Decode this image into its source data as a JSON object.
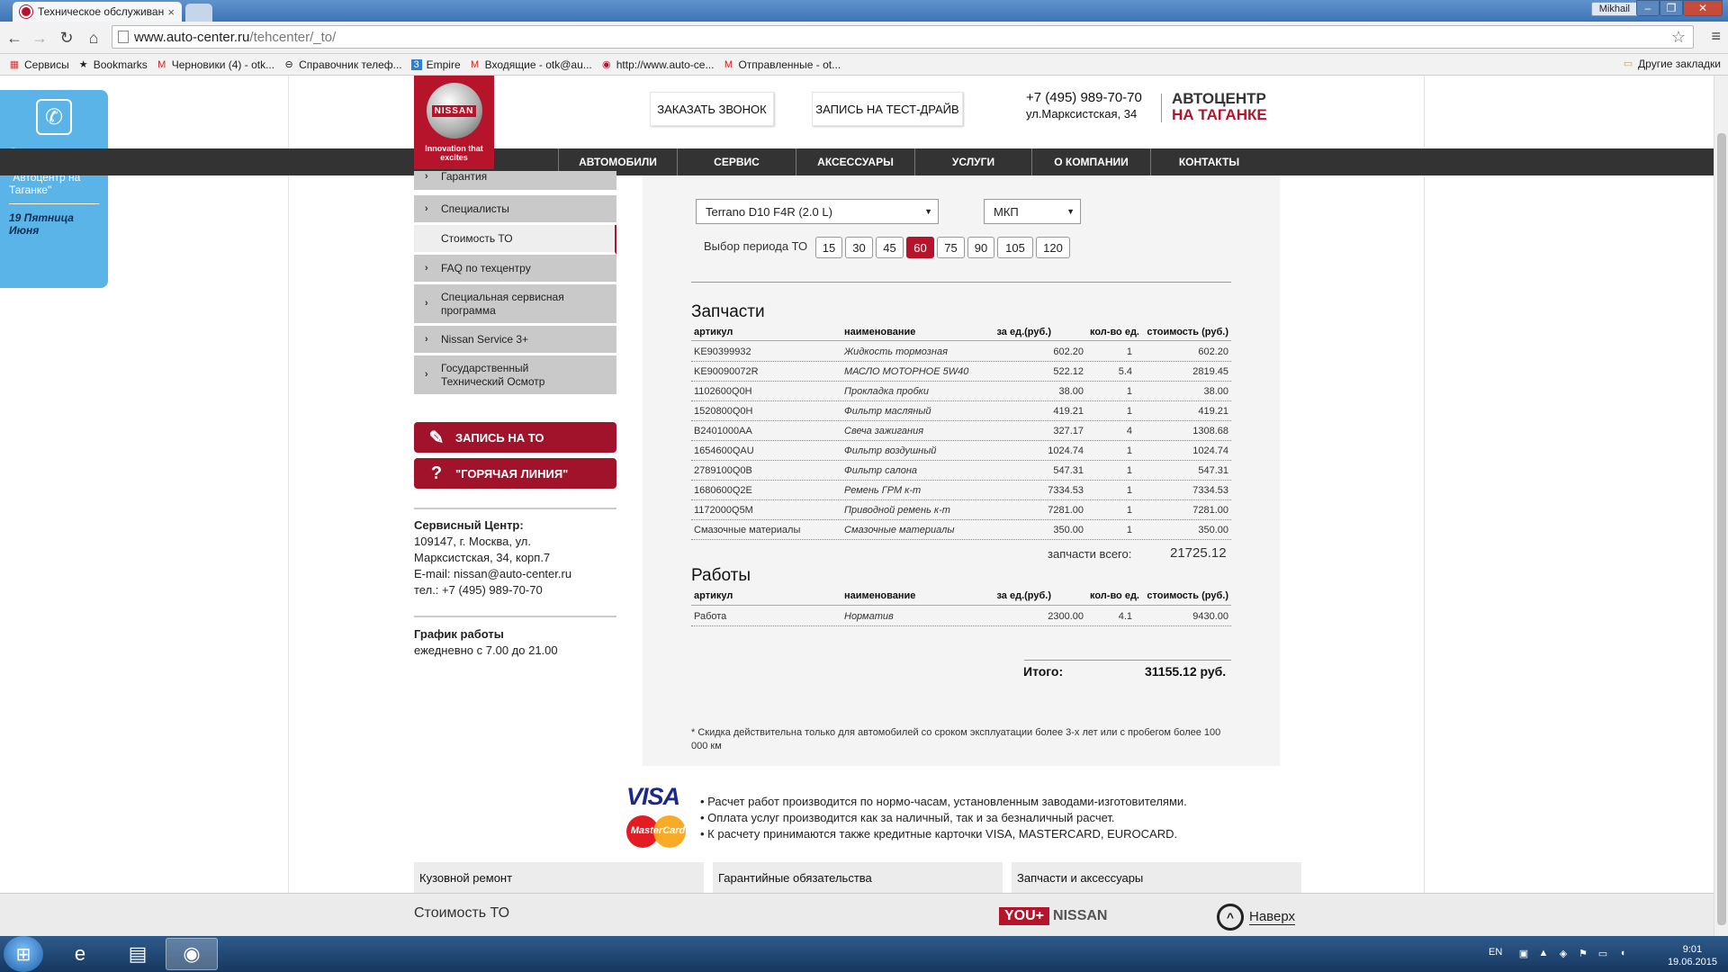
{
  "browser": {
    "tab_title": "Техническое обслуживан",
    "tab_close": "×",
    "user": "Mikhail",
    "url_host": "www.auto-center.ru",
    "url_path": "/tehcenter/_to/",
    "bookmarks": [
      {
        "icon": "apps-icon",
        "label": "Сервисы"
      },
      {
        "icon": "star-icon",
        "label": "Bookmarks"
      },
      {
        "icon": "gmail-icon",
        "label": "Черновики (4) - otk..."
      },
      {
        "icon": "phone-book-icon",
        "label": "Справочник телеф..."
      },
      {
        "icon": "empire-icon",
        "label": "Empire"
      },
      {
        "icon": "gmail-icon",
        "label": "Входящие - otk@au..."
      },
      {
        "icon": "site-icon",
        "label": "http://www.auto-ce..."
      },
      {
        "icon": "gmail-icon",
        "label": "Отправленные - ot..."
      }
    ],
    "other_bookmarks": "Другие закладки"
  },
  "sidephone": {
    "text": "Справочник телефонов \"Автоцентр на Таганке\"",
    "day": "19 Пятница Июня"
  },
  "header": {
    "logo_text": "NISSAN",
    "logo_tagline": "Innovation that excites",
    "call_button": "ЗАКАЗАТЬ ЗВОНОК",
    "testdrive_button": "ЗАПИСЬ НА ТЕСТ-ДРАЙВ",
    "phone": "+7 (495) 989-70-70",
    "address": "ул.Марксистская, 34",
    "brand_line1": "АВТОЦЕНТР",
    "brand_line2": "НА ТАГАНКЕ"
  },
  "nav": [
    "АВТОМОБИЛИ",
    "СЕРВИС",
    "АКСЕССУАРЫ",
    "УСЛУГИ",
    "О КОМПАНИИ",
    "КОНТАКТЫ"
  ],
  "leftmenu": {
    "items": [
      {
        "label": "Гарантия",
        "chev": true
      },
      {
        "label": "Специалисты",
        "chev": true
      },
      {
        "label": "Стоимость ТО",
        "chev": false,
        "active": true
      },
      {
        "label": "FAQ по техцентру",
        "chev": true
      },
      {
        "label": "Специальная сервисная программа",
        "chev": true
      },
      {
        "label": "Nissan Service 3+",
        "chev": true
      },
      {
        "label": "Государственный Технический Осмотр",
        "chev": true
      }
    ],
    "btn_to": "ЗАПИСЬ НА ТО",
    "btn_hotline": "\"ГОРЯЧАЯ ЛИНИЯ\"",
    "service_title": "Сервисный Центр:",
    "service_addr1": "109147, г. Москва, ул.",
    "service_addr2": "Марксистская, 34, корп.7",
    "service_email": "E-mail: nissan@auto-center.ru",
    "service_phone": "тел.: +7 (495) 989-70-70",
    "schedule_title": "График работы",
    "schedule_text": "ежедневно с 7.00 до 21.00"
  },
  "calc": {
    "model": "Terrano D10 F4R (2.0 L)",
    "gearbox": "МКП",
    "period_label": "Выбор периода ТО",
    "periods": [
      "15",
      "30",
      "45",
      "60",
      "75",
      "90",
      "105",
      "120"
    ],
    "period_selected": "60",
    "parts_title": "Запчасти",
    "columns": [
      "артикул",
      "наименование",
      "за ед.(руб.)",
      "кол-во ед.",
      "стоимость (руб.)"
    ],
    "parts": [
      [
        "KE90399932",
        "Жидкость тормозная",
        "602.20",
        "1",
        "602.20"
      ],
      [
        "KE90090072R",
        "МАСЛО МОТОРНОЕ 5W40",
        "522.12",
        "5.4",
        "2819.45"
      ],
      [
        "1102600Q0H",
        "Прокладка пробки",
        "38.00",
        "1",
        "38.00"
      ],
      [
        "1520800Q0H",
        "Фильтр масляный",
        "419.21",
        "1",
        "419.21"
      ],
      [
        "B2401000AA",
        "Свеча зажигания",
        "327.17",
        "4",
        "1308.68"
      ],
      [
        "1654600QAU",
        "Фильтр воздушный",
        "1024.74",
        "1",
        "1024.74"
      ],
      [
        "2789100Q0B",
        "Фильтр салона",
        "547.31",
        "1",
        "547.31"
      ],
      [
        "1680600Q2E",
        "Ремень ГРМ к-т",
        "7334.53",
        "1",
        "7334.53"
      ],
      [
        "1172000Q5M",
        "Приводной ремень к-т",
        "7281.00",
        "1",
        "7281.00"
      ],
      [
        "Смазочные материалы",
        "Смазочные материалы",
        "350.00",
        "1",
        "350.00"
      ]
    ],
    "parts_total_label": "запчасти всего:",
    "parts_total": "21725.12",
    "works_title": "Работы",
    "works": [
      [
        "Работа",
        "Норматив",
        "2300.00",
        "4.1",
        "9430.00"
      ]
    ],
    "total_label": "Итого:",
    "total": "31155.12 руб.",
    "note": "* Скидка действительна только для автомобилей со сроком эксплуатации более 3-х лет или с пробегом более 100 000 км"
  },
  "payment": {
    "visa": "VISA",
    "mastercard": "MasterCard",
    "lines": [
      "• Расчет работ производится по нормо-часам, установленным заводами-изготовителями.",
      "• Оплата услуг производится как за наличный, так и за безналичный расчет.",
      "• К расчету принимаются также кредитные карточки VISA, MASTERCARD, EUROCARD."
    ]
  },
  "footer_links": [
    "Кузовной ремонт",
    "Гарантийные обязательства",
    "Запчасти и аксессуары"
  ],
  "bottom": {
    "title": "Стоимость ТО",
    "you": "YOU+",
    "nissan": "NISSAN",
    "up": "Наверх"
  },
  "taskbar": {
    "lang": "EN",
    "time": "9:01",
    "date": "19.06.2015"
  },
  "colors": {
    "accent": "#b6142b",
    "nav": "#333333",
    "panel": "#f4f4f4",
    "sidephone": "#5ab4e8"
  }
}
